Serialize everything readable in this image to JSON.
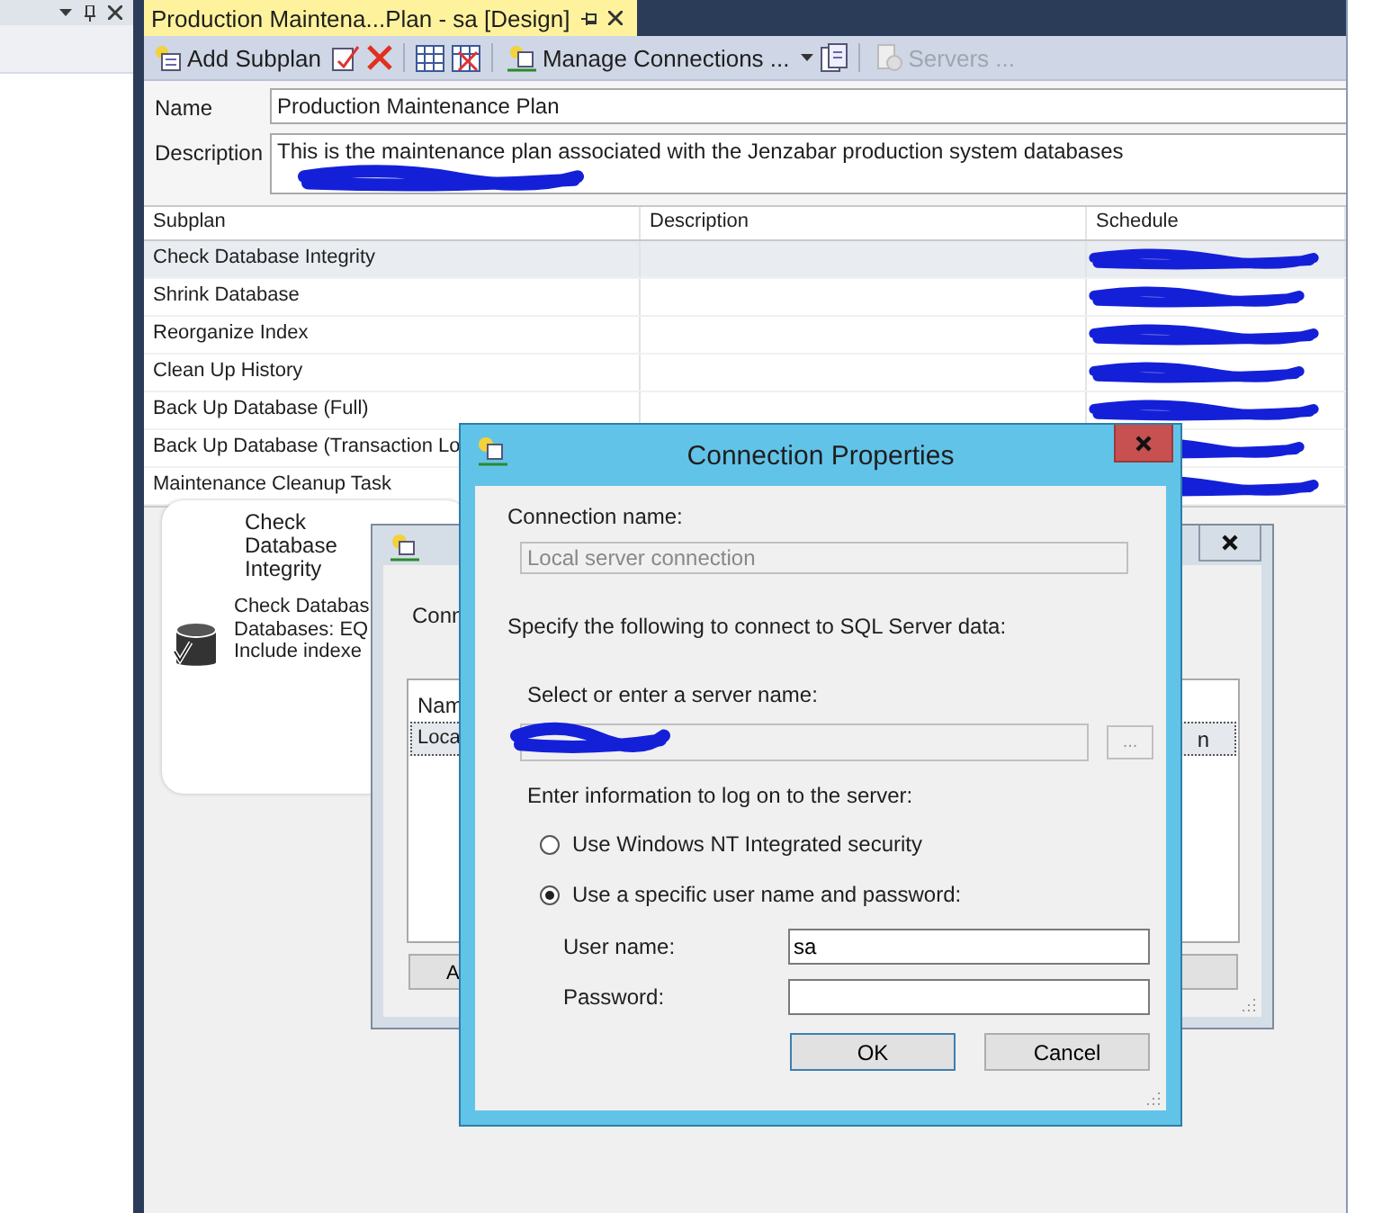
{
  "document_tab": {
    "title": "Production Maintena...Plan - sa [Design]",
    "selected": true
  },
  "toolbar": {
    "add_subplan": "Add Subplan",
    "manage_connections": "Manage Connections ...",
    "servers": {
      "label": "Servers ...",
      "disabled": true
    }
  },
  "plan": {
    "name_label": "Name",
    "name": "Production Maintenance Plan",
    "description_label": "Description",
    "description": "This is the maintenance plan associated with the Jenzabar production system databases"
  },
  "subplans": {
    "columns": [
      "Subplan",
      "Description",
      "Schedule"
    ],
    "rows": [
      {
        "subplan": "Check Database Integrity",
        "selected": true
      },
      {
        "subplan": "Shrink Database",
        "selected": false
      },
      {
        "subplan": "Reorganize Index",
        "selected": false
      },
      {
        "subplan": "Clean Up History",
        "selected": false
      },
      {
        "subplan": "Back Up Database (Full)",
        "selected": false
      },
      {
        "subplan": "Back Up Database (Transaction Lo",
        "selected": false
      },
      {
        "subplan": "Maintenance Cleanup Task",
        "selected": false
      }
    ]
  },
  "task_card": {
    "title": "Check Database Integrity",
    "lines": [
      "Check Databas",
      "Databases: EQ",
      "Include indexe"
    ]
  },
  "connections_dialog": {
    "label": "Conn",
    "column": "Nam",
    "row": "Loca",
    "row_end": "n",
    "button": "A"
  },
  "connection_properties": {
    "title": "Connection Properties",
    "connection_name_label": "Connection name:",
    "connection_name": "Local server connection",
    "specify_text": "Specify the following to connect to SQL Server data:",
    "server_label": "Select or enter a server name:",
    "browse_button": "...",
    "logon_label": "Enter information to log on to the server:",
    "auth_options": [
      {
        "label": "Use Windows NT Integrated security",
        "selected": false
      },
      {
        "label": "Use a specific user name and password:",
        "selected": true
      }
    ],
    "user_name_label": "User name:",
    "user_name": "sa",
    "password_label": "Password:",
    "buttons": [
      "OK",
      "Cancel"
    ]
  }
}
